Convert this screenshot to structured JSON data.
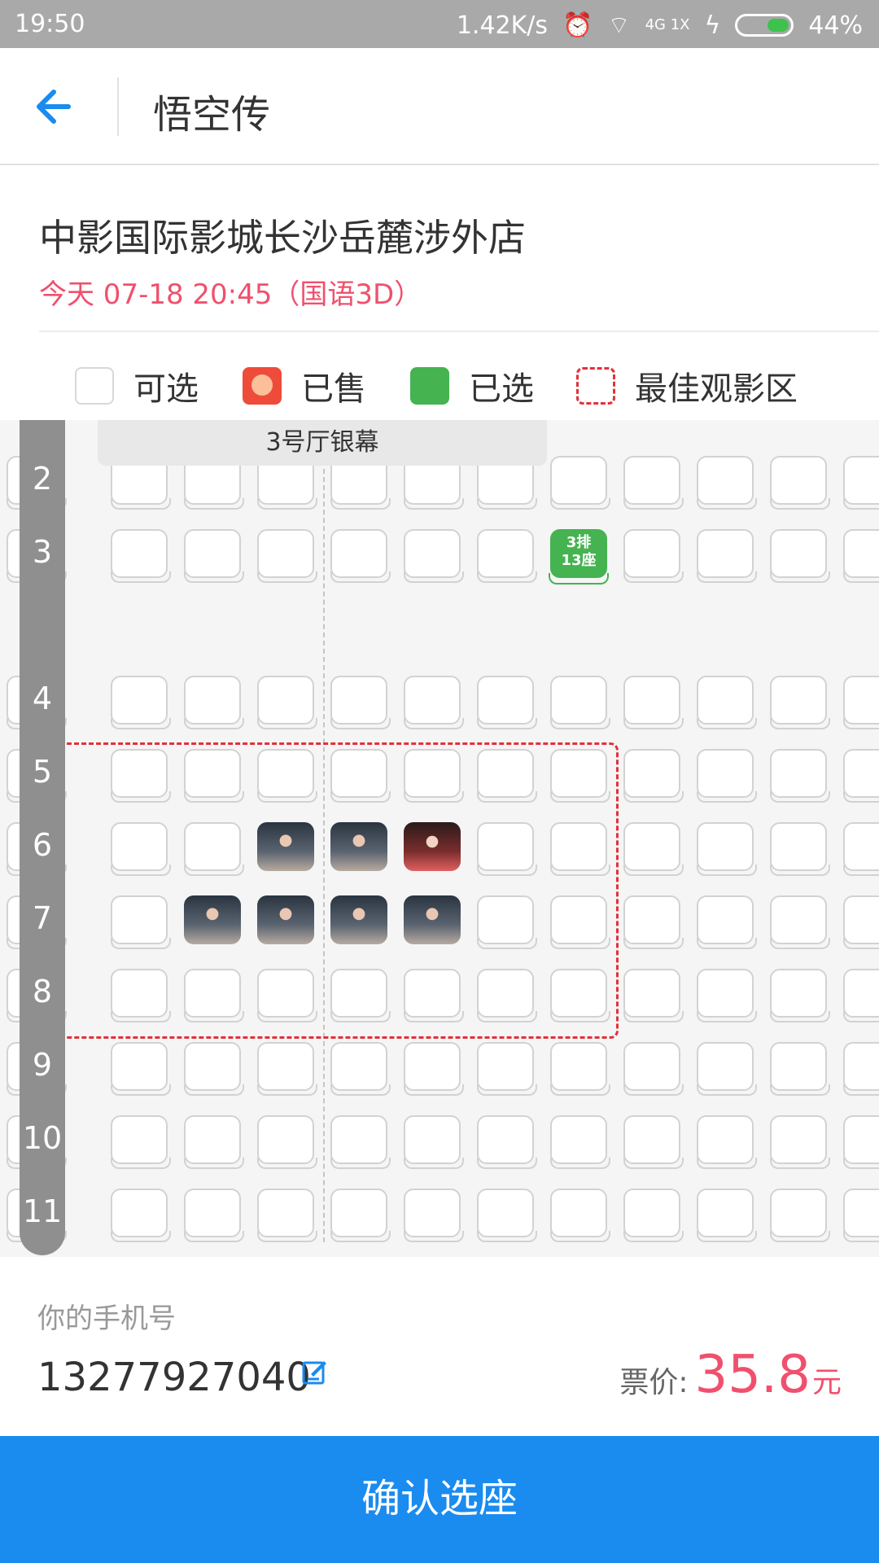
{
  "status_bar": {
    "time": "19:50",
    "speed": "1.42K/s",
    "network": "4G 1X",
    "battery": "44%"
  },
  "header": {
    "title": "悟空传"
  },
  "cinema": {
    "name": "中影国际影城长沙岳麓涉外店",
    "showtime": "今天 07-18  20:45（国语3D）"
  },
  "legend": {
    "available": "可选",
    "sold": "已售",
    "selected": "已选",
    "best": "最佳观影区"
  },
  "seatmap": {
    "screen_label": "3号厅银幕",
    "rows": [
      "2",
      "3",
      "4",
      "5",
      "6",
      "7",
      "8",
      "9",
      "10",
      "11"
    ],
    "selected_seat_text": "3排\n13座",
    "colors": {
      "selected": "#45b350",
      "best_zone": "#e0323a"
    }
  },
  "bottom": {
    "phone_label": "你的手机号",
    "phone": "13277927040",
    "price_label": "票价:",
    "price": "35.8",
    "price_unit": "元"
  },
  "confirm_label": "确认选座",
  "accent": "#1a8bef"
}
